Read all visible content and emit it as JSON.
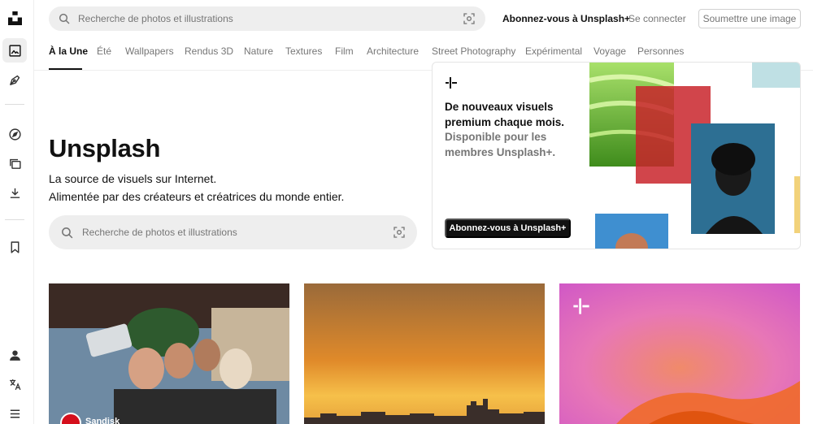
{
  "sidebar": {
    "items": [
      {
        "icon": "unsplash-logo-icon"
      },
      {
        "icon": "image-icon",
        "active": true
      },
      {
        "icon": "pen-icon"
      },
      {
        "icon": "compass-icon"
      },
      {
        "icon": "collection-icon"
      },
      {
        "icon": "download-icon"
      },
      {
        "icon": "bookmark-icon"
      },
      {
        "icon": "user-icon"
      },
      {
        "icon": "language-icon"
      },
      {
        "icon": "menu-icon"
      }
    ]
  },
  "header": {
    "search_placeholder": "Recherche de photos et illustrations",
    "subscribe_label": "Abonnez-vous à Unsplash+",
    "login_label": "Se connecter",
    "submit_label": "Soumettre une image"
  },
  "tabs": [
    {
      "label": "À la Une",
      "active": true
    },
    {
      "label": "Été"
    },
    {
      "label": "Wallpapers"
    },
    {
      "label": "Rendus 3D"
    },
    {
      "label": "Nature"
    },
    {
      "label": "Textures"
    },
    {
      "label": "Film"
    },
    {
      "label": "Architecture"
    },
    {
      "label": "Street Photography"
    },
    {
      "label": "Expérimental"
    },
    {
      "label": "Voyage"
    },
    {
      "label": "Personnes"
    }
  ],
  "hero": {
    "title": "Unsplash",
    "line1": "La source de visuels sur Internet.",
    "line2": "Alimentée par des créateurs et créatrices du monde entier.",
    "search_placeholder": "Recherche de photos et illustrations"
  },
  "promo": {
    "headline": "De nouveaux visuels premium chaque mois.",
    "subline": "Disponible pour les membres Unsplash+.",
    "button_label": "Abonnez-vous à Unsplash+"
  },
  "photos": [
    {
      "sponsor": "Sandisk"
    },
    {},
    {}
  ],
  "colors": {
    "accent": "#111111",
    "muted": "#767676",
    "search_bg": "#eeeeee"
  }
}
